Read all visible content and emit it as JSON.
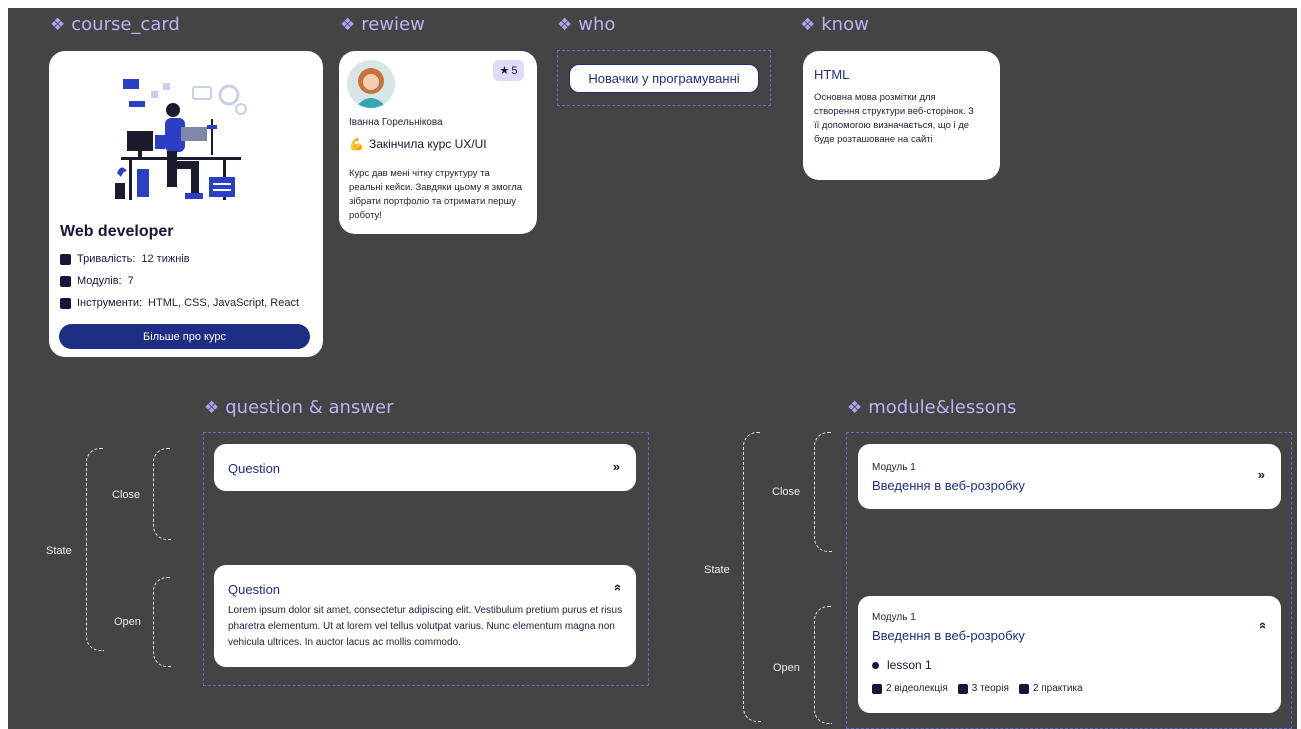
{
  "sections": {
    "course_card": "course_card",
    "review": "rewiew",
    "who": "who",
    "know": "know",
    "qa": "question & answer",
    "modules": "module&lessons"
  },
  "section_icon": "diamond-four-icon",
  "course_card": {
    "title": "Web developer",
    "duration_label": "Тривалість:",
    "duration_value": "12 тижнів",
    "modules_label": "Модулів:",
    "modules_value": "7",
    "tools_label": "Інструменти:",
    "tools_value": "HTML, CSS, JavaScript, React",
    "button": "Більше про курс"
  },
  "review": {
    "rating": "5",
    "name": "Іванна Горельнікова",
    "course": "Закінчила курс UX/UI",
    "text": "Курс дав мені чітку структуру та реальні кейси. Завдяки цьому я змогла зібрати портфоліо та отримати першу роботу!"
  },
  "who": {
    "label": "Новачки у програмуванні"
  },
  "know": {
    "title": "HTML",
    "text": "Основна мова розмітки для створення структури веб-сторінок. З її допомогою визначається, що і де буде розташоване на сайті"
  },
  "qa": {
    "state_label": "State",
    "close_label": "Close",
    "open_label": "Open",
    "closed_question": "Question",
    "open_question": "Question",
    "open_answer": "Lorem ipsum dolor sit amet, consectetur adipiscing elit. Vestibulum pretium purus et risus pharetra elementum. Ut at lorem vel tellus volutpat varius. Nunc elementum magna non vehicula ultrices. In auctor lacus ac mollis commodo."
  },
  "modules": {
    "state_label": "State",
    "close_label": "Close",
    "open_label": "Open",
    "closed": {
      "number": "Модуль 1",
      "title": "Введення в веб-розробку"
    },
    "open": {
      "number": "Модуль 1",
      "title": "Введення в веб-розробку",
      "lesson": "lesson 1",
      "videos": "2 відеолекція",
      "theory": "3 теорія",
      "practice": "2 практика"
    }
  },
  "colors": {
    "background": "#444444",
    "section_title": "#b8b3f2",
    "primary": "#1f2e85",
    "card": "#ffffff"
  }
}
